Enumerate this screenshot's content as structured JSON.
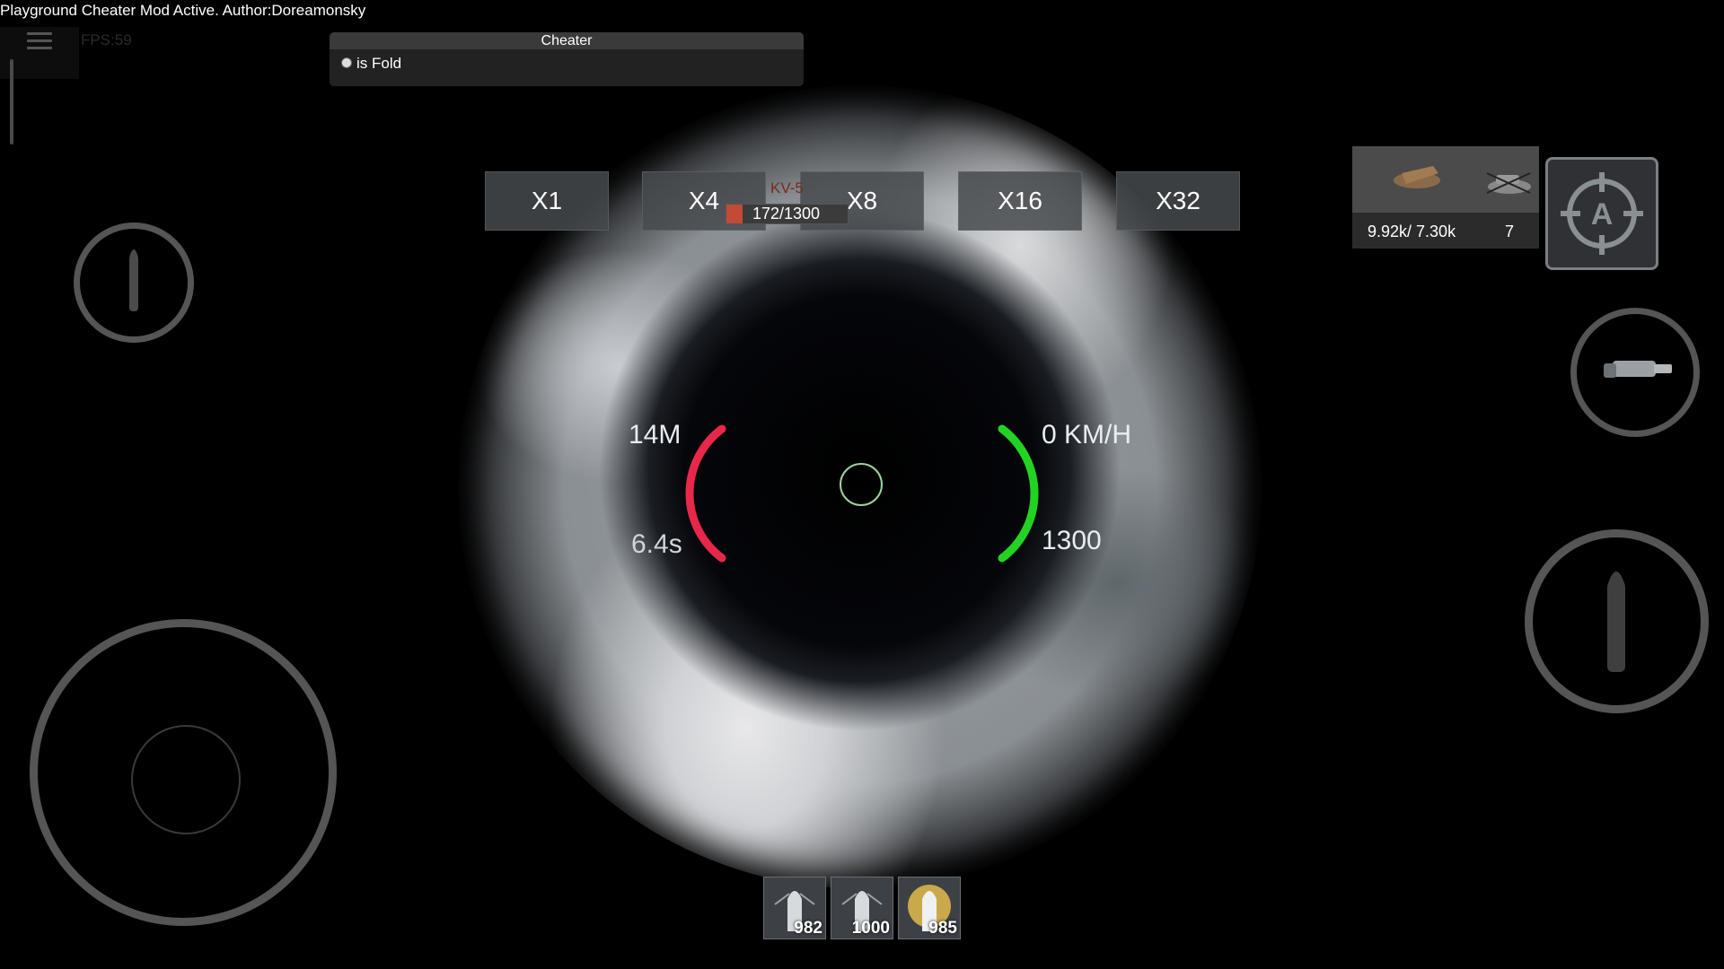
{
  "top_bar": {
    "mod_banner": "Playground Cheater Mod Active. Author:Doreamonsky",
    "fps": "FPS:59"
  },
  "cheater_panel": {
    "title": "Cheater",
    "toggle_label": "is Fold"
  },
  "zoom_buttons": [
    "X1",
    "X4",
    "X8",
    "X16",
    "X32"
  ],
  "target": {
    "name": "KV-5",
    "hp_text": "172/1300",
    "hp_fraction": 0.13
  },
  "scope_readouts": {
    "range": "14M",
    "reload": "6.4s",
    "speed": "0 KM/H",
    "hp": "1300"
  },
  "stats_panel": {
    "damage": "9.92k/ 7.30k",
    "kills": "7"
  },
  "ammo_slots": [
    {
      "count": "982",
      "icon": "ap-shell-icon"
    },
    {
      "count": "1000",
      "icon": "apcr-shell-icon"
    },
    {
      "count": "985",
      "icon": "he-shell-icon"
    }
  ],
  "colors": {
    "reload_arc": "#e8284a",
    "hp_arc": "#22d322",
    "crosshair": "#9fd2a0",
    "target_name": "#7a2a1e",
    "target_bar": "#c14b36"
  }
}
